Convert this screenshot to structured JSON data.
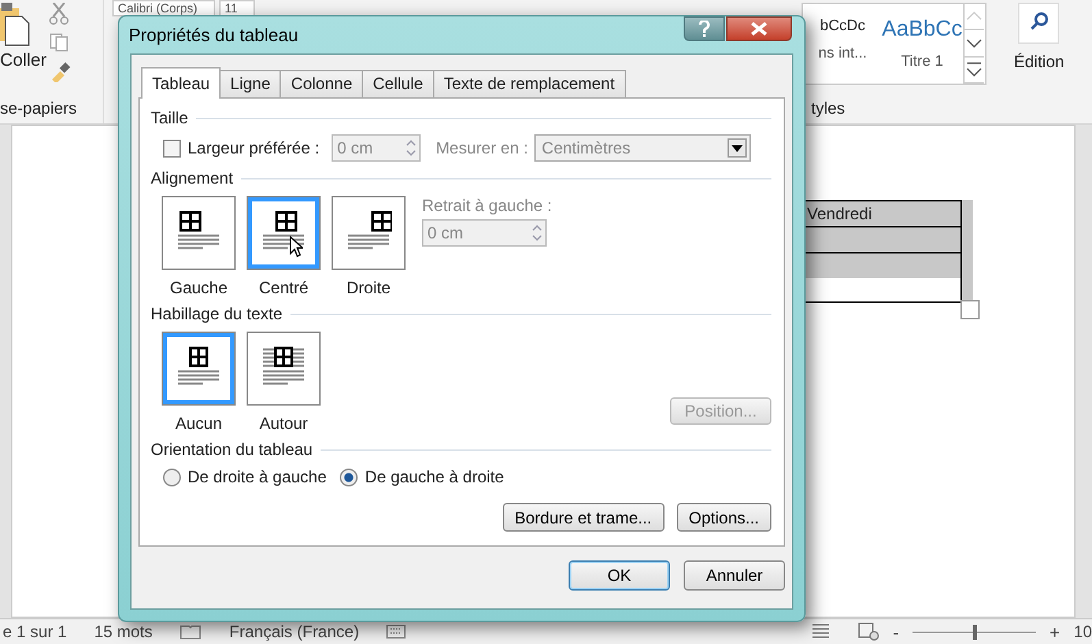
{
  "ribbon": {
    "clipboard": {
      "paste_label": "Coller",
      "group_label": "se-papiers"
    },
    "font": {
      "font_name": "Calibri (Corps)",
      "font_size": "11"
    },
    "styles": {
      "items": [
        {
          "preview": "bCcDc",
          "name": "ns int...",
          "kind": "normal"
        },
        {
          "preview": "AaBbCc",
          "name": "Titre 1",
          "kind": "heading"
        }
      ],
      "group_label": "tyles"
    },
    "editing": {
      "label": "Édition"
    }
  },
  "document": {
    "table_rows": [
      {
        "text": "Vendredi",
        "shaded": true
      },
      {
        "shaded": true
      },
      {
        "shaded": true
      }
    ]
  },
  "dialog": {
    "title": "Propriétés du tableau",
    "tabs": [
      {
        "label": "Tableau",
        "selected": true
      },
      {
        "label": "Ligne",
        "selected": false
      },
      {
        "label": "Colonne",
        "selected": false
      },
      {
        "label": "Cellule",
        "selected": false
      },
      {
        "label": "Texte de remplacement",
        "selected": false
      }
    ],
    "size": {
      "heading": "Taille",
      "preferred_width": {
        "label": "Largeur préférée :",
        "checked": false,
        "value": "0 cm",
        "disabled": true
      },
      "measure_in": {
        "label": "Mesurer en :",
        "value": "Centimètres",
        "disabled": true
      }
    },
    "alignment": {
      "heading": "Alignement",
      "options": [
        {
          "label": "Gauche",
          "kind": "left",
          "selected": false
        },
        {
          "label": "Centré",
          "kind": "center",
          "selected": true
        },
        {
          "label": "Droite",
          "kind": "right",
          "selected": false
        }
      ],
      "indent": {
        "label": "Retrait à gauche :",
        "value": "0 cm",
        "disabled": true
      }
    },
    "wrapping": {
      "heading": "Habillage du texte",
      "options": [
        {
          "label": "Aucun",
          "kind": "none",
          "selected": true
        },
        {
          "label": "Autour",
          "kind": "around",
          "selected": false
        }
      ],
      "position_button": {
        "label": "Position...",
        "disabled": true
      }
    },
    "direction": {
      "heading": "Orientation du tableau",
      "options": [
        {
          "label": "De droite à gauche",
          "checked": false
        },
        {
          "label": "De gauche à droite",
          "checked": true
        }
      ]
    },
    "panel_buttons": [
      "Bordure et trame...",
      "Options..."
    ],
    "buttons": [
      {
        "label": "OK",
        "default": true
      },
      {
        "label": "Annuler",
        "default": false
      }
    ]
  },
  "status_bar": {
    "page": "e 1 sur 1",
    "words": "15 mots",
    "language": "Français (France)",
    "zoom_out": "-",
    "zoom_slider": {
      "level": 0.5
    },
    "zoom_in": "+",
    "zoom": "10"
  }
}
